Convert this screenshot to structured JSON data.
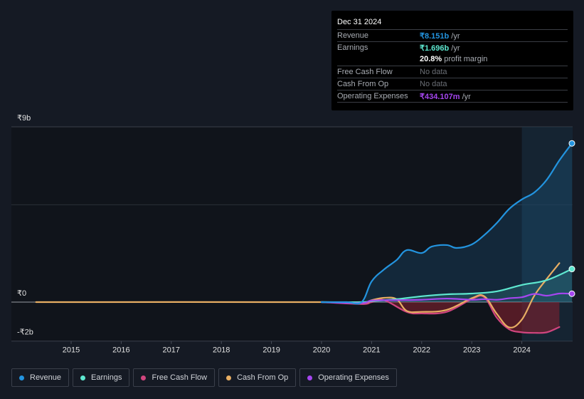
{
  "tooltip": {
    "date": "Dec 31 2024",
    "rows": [
      {
        "label": "Revenue",
        "value": "₹8.151b",
        "suffix": " /yr",
        "color": "#2394df"
      },
      {
        "label": "Earnings",
        "value": "₹1.696b",
        "suffix": " /yr",
        "color": "#5ee8d0"
      },
      {
        "label": "",
        "value": "20.8%",
        "suffix": " profit margin",
        "color": "#ffffff"
      },
      {
        "label": "Free Cash Flow",
        "value": "No data",
        "suffix": "",
        "color": "#6b6f76"
      },
      {
        "label": "Cash From Op",
        "value": "No data",
        "suffix": "",
        "color": "#6b6f76"
      },
      {
        "label": "Operating Expenses",
        "value": "₹434.107m",
        "suffix": " /yr",
        "color": "#a546f0"
      }
    ]
  },
  "legend": [
    {
      "label": "Revenue",
      "color": "#2394df"
    },
    {
      "label": "Earnings",
      "color": "#5ee8d0"
    },
    {
      "label": "Free Cash Flow",
      "color": "#d0457e"
    },
    {
      "label": "Cash From Op",
      "color": "#e8ae63"
    },
    {
      "label": "Operating Expenses",
      "color": "#a546f0"
    }
  ],
  "chart_data": {
    "type": "line",
    "title": "",
    "xlabel": "",
    "ylabel": "",
    "xlim": [
      2013.8,
      2025.0
    ],
    "ylim": [
      -2,
      9
    ],
    "y_ticks": [
      {
        "value": 9,
        "label": "₹9b"
      },
      {
        "value": 0,
        "label": "₹0"
      },
      {
        "value": -2,
        "label": "-₹2b"
      }
    ],
    "x_ticks": [
      2015,
      2016,
      2017,
      2018,
      2019,
      2020,
      2021,
      2022,
      2023,
      2024
    ],
    "grid": true,
    "highlight_from": 2024.0,
    "legend_position": "bottom",
    "units": "₹ billions",
    "series": [
      {
        "name": "Revenue",
        "color": "#2394df",
        "fill": true,
        "end_marker": true,
        "x": [
          2020.0,
          2020.5,
          2020.8,
          2021.0,
          2021.25,
          2021.5,
          2021.7,
          2022.0,
          2022.2,
          2022.5,
          2022.7,
          2023.0,
          2023.25,
          2023.5,
          2023.75,
          2024.0,
          2024.25,
          2024.5,
          2024.75,
          2025.0
        ],
        "y": [
          0,
          0,
          0,
          1.06,
          1.68,
          2.16,
          2.67,
          2.52,
          2.85,
          2.93,
          2.78,
          2.96,
          3.44,
          4.06,
          4.79,
          5.27,
          5.63,
          6.29,
          7.28,
          8.15
        ]
      },
      {
        "name": "Earnings",
        "color": "#5ee8d0",
        "fill": true,
        "end_marker": true,
        "x": [
          2020.0,
          2020.8,
          2021.0,
          2021.5,
          2022.0,
          2022.5,
          2023.0,
          2023.5,
          2024.0,
          2024.5,
          2025.0
        ],
        "y": [
          0,
          0,
          0.05,
          0.15,
          0.3,
          0.4,
          0.44,
          0.55,
          0.88,
          1.13,
          1.7
        ]
      },
      {
        "name": "Free Cash Flow",
        "color": "#d0457e",
        "fill": "negative",
        "x": [
          2020.0,
          2020.8,
          2021.0,
          2021.25,
          2021.7,
          2022.0,
          2022.5,
          2023.0,
          2023.25,
          2023.5,
          2023.75,
          2024.0,
          2024.25,
          2024.5,
          2024.75
        ],
        "y": [
          0,
          -0.1,
          0,
          0.1,
          -0.5,
          -0.58,
          -0.5,
          0.15,
          0.25,
          -0.8,
          -1.4,
          -1.55,
          -1.58,
          -1.55,
          -1.28
        ]
      },
      {
        "name": "Cash From Op",
        "color": "#e8ae63",
        "fill": false,
        "x": [
          2014.3,
          2020.0,
          2020.8,
          2021.0,
          2021.25,
          2021.5,
          2021.7,
          2022.0,
          2022.5,
          2023.0,
          2023.25,
          2023.5,
          2023.75,
          2024.0,
          2024.25,
          2024.5,
          2024.75
        ],
        "y": [
          0,
          0,
          -0.05,
          0.1,
          0.22,
          0.15,
          -0.45,
          -0.5,
          -0.4,
          0.2,
          0.3,
          -0.6,
          -1.3,
          -0.9,
          0.33,
          1.2,
          2.0
        ]
      },
      {
        "name": "Operating Expenses",
        "color": "#a546f0",
        "fill": false,
        "end_marker": true,
        "x": [
          2020.0,
          2020.8,
          2021.0,
          2021.5,
          2022.0,
          2022.5,
          2023.0,
          2023.25,
          2023.5,
          2023.75,
          2024.0,
          2024.25,
          2024.5,
          2024.75,
          2025.0
        ],
        "y": [
          0,
          -0.05,
          0.08,
          0.1,
          0.12,
          0.18,
          0.12,
          0.15,
          0.12,
          0.2,
          0.25,
          0.42,
          0.33,
          0.44,
          0.43
        ]
      }
    ]
  }
}
